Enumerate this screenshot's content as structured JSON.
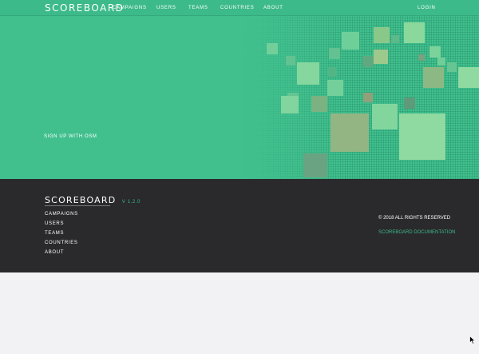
{
  "header": {
    "brand": "SCOREBOARD",
    "nav": [
      "CAMPAIGNS",
      "USERS",
      "TEAMS",
      "COUNTRIES",
      "ABOUT"
    ],
    "login": "LOGIN"
  },
  "hero": {
    "signup": "SIGN UP WITH OSM"
  },
  "footer": {
    "brand": "SCOREBOARD",
    "version": "V 1.2.0",
    "nav": [
      "CAMPAIGNS",
      "USERS",
      "TEAMS",
      "COUNTRIES",
      "ABOUT"
    ],
    "copyright": "© 2018 ALL RIGHTS RESERVED",
    "docs": "SCOREBOARD DOCUMENTATION"
  },
  "colors": {
    "primary": "#3dba8a",
    "hero_bg": "#41c08e",
    "footer_bg": "#2a292c",
    "page_bg": "#f2f1f3"
  }
}
